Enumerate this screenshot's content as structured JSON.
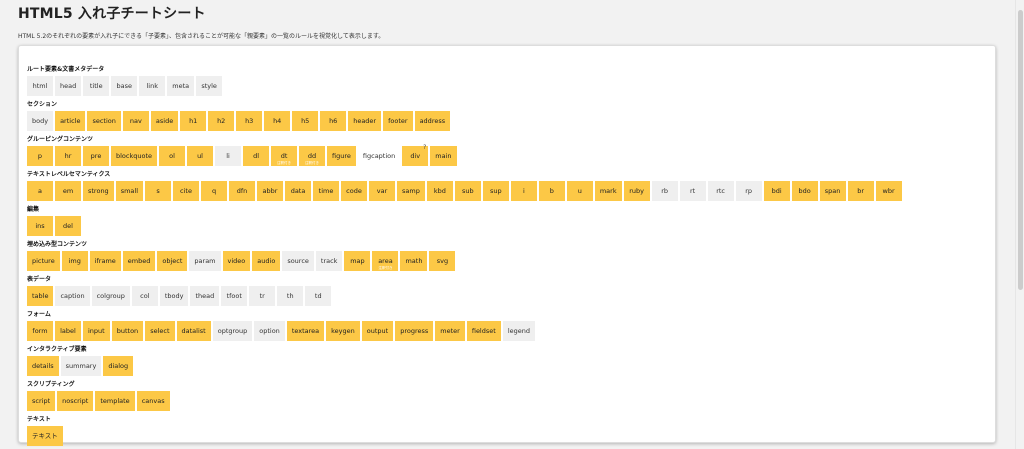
{
  "title": "HTML5 入れ子チートシート",
  "description": "HTML 5.2のそれぞれの要素が入れ子にできる「子要素」、包含されることが可能な「親要素」の一覧のルールを視覚化して表示します。",
  "colors": {
    "highlight": "#fcc846",
    "neutral": "#efefef"
  },
  "sections": [
    {
      "title": "ルート要素&文書メタデータ",
      "items": [
        {
          "label": "html",
          "state": "g"
        },
        {
          "label": "head",
          "state": "g"
        },
        {
          "label": "title",
          "state": "g"
        },
        {
          "label": "base",
          "state": "g"
        },
        {
          "label": "link",
          "state": "g"
        },
        {
          "label": "meta",
          "state": "g"
        },
        {
          "label": "style",
          "state": "g"
        }
      ]
    },
    {
      "title": "セクション",
      "items": [
        {
          "label": "body",
          "state": "g"
        },
        {
          "label": "article",
          "state": "y"
        },
        {
          "label": "section",
          "state": "y"
        },
        {
          "label": "nav",
          "state": "y"
        },
        {
          "label": "aside",
          "state": "y"
        },
        {
          "label": "h1",
          "state": "y"
        },
        {
          "label": "h2",
          "state": "y"
        },
        {
          "label": "h3",
          "state": "y"
        },
        {
          "label": "h4",
          "state": "y"
        },
        {
          "label": "h5",
          "state": "y"
        },
        {
          "label": "h6",
          "state": "y"
        },
        {
          "label": "header",
          "state": "y"
        },
        {
          "label": "footer",
          "state": "y"
        },
        {
          "label": "address",
          "state": "y"
        }
      ]
    },
    {
      "title": "グルーピングコンテンツ",
      "items": [
        {
          "label": "p",
          "state": "y"
        },
        {
          "label": "hr",
          "state": "y"
        },
        {
          "label": "pre",
          "state": "y"
        },
        {
          "label": "blockquote",
          "state": "y"
        },
        {
          "label": "ol",
          "state": "y"
        },
        {
          "label": "ul",
          "state": "y"
        },
        {
          "label": "li",
          "state": "g"
        },
        {
          "label": "dl",
          "state": "y"
        },
        {
          "label": "dt",
          "state": "y",
          "sub": "注釈付き"
        },
        {
          "label": "dd",
          "state": "y",
          "sub": "注釈付き"
        },
        {
          "label": "figure",
          "state": "y"
        },
        {
          "label": "figcaption",
          "state": "w"
        },
        {
          "label": "div",
          "state": "y",
          "mark": "?"
        },
        {
          "label": "main",
          "state": "y"
        }
      ]
    },
    {
      "title": "テキストレベルセマンティクス",
      "items": [
        {
          "label": "a",
          "state": "y"
        },
        {
          "label": "em",
          "state": "y"
        },
        {
          "label": "strong",
          "state": "y"
        },
        {
          "label": "small",
          "state": "y"
        },
        {
          "label": "s",
          "state": "y"
        },
        {
          "label": "cite",
          "state": "y"
        },
        {
          "label": "q",
          "state": "y"
        },
        {
          "label": "dfn",
          "state": "y"
        },
        {
          "label": "abbr",
          "state": "y"
        },
        {
          "label": "data",
          "state": "y"
        },
        {
          "label": "time",
          "state": "y"
        },
        {
          "label": "code",
          "state": "y"
        },
        {
          "label": "var",
          "state": "y"
        },
        {
          "label": "samp",
          "state": "y"
        },
        {
          "label": "kbd",
          "state": "y"
        },
        {
          "label": "sub",
          "state": "y"
        },
        {
          "label": "sup",
          "state": "y"
        },
        {
          "label": "i",
          "state": "y"
        },
        {
          "label": "b",
          "state": "y"
        },
        {
          "label": "u",
          "state": "y"
        },
        {
          "label": "mark",
          "state": "y"
        },
        {
          "label": "ruby",
          "state": "y"
        },
        {
          "label": "rb",
          "state": "g"
        },
        {
          "label": "rt",
          "state": "g"
        },
        {
          "label": "rtc",
          "state": "g"
        },
        {
          "label": "rp",
          "state": "g"
        },
        {
          "label": "bdi",
          "state": "y"
        },
        {
          "label": "bdo",
          "state": "y"
        },
        {
          "label": "span",
          "state": "y"
        },
        {
          "label": "br",
          "state": "y"
        },
        {
          "label": "wbr",
          "state": "y"
        }
      ]
    },
    {
      "title": "編集",
      "items": [
        {
          "label": "ins",
          "state": "y"
        },
        {
          "label": "del",
          "state": "y"
        }
      ]
    },
    {
      "title": "埋め込み型コンテンツ",
      "items": [
        {
          "label": "picture",
          "state": "y"
        },
        {
          "label": "img",
          "state": "y"
        },
        {
          "label": "iframe",
          "state": "y"
        },
        {
          "label": "embed",
          "state": "y"
        },
        {
          "label": "object",
          "state": "y"
        },
        {
          "label": "param",
          "state": "g"
        },
        {
          "label": "video",
          "state": "y"
        },
        {
          "label": "audio",
          "state": "y"
        },
        {
          "label": "source",
          "state": "g"
        },
        {
          "label": "track",
          "state": "g"
        },
        {
          "label": "map",
          "state": "y"
        },
        {
          "label": "area",
          "state": "y",
          "sub": "注釈付き"
        },
        {
          "label": "math",
          "state": "y"
        },
        {
          "label": "svg",
          "state": "y"
        }
      ]
    },
    {
      "title": "表データ",
      "items": [
        {
          "label": "table",
          "state": "y"
        },
        {
          "label": "caption",
          "state": "g"
        },
        {
          "label": "colgroup",
          "state": "g"
        },
        {
          "label": "col",
          "state": "g"
        },
        {
          "label": "tbody",
          "state": "g"
        },
        {
          "label": "thead",
          "state": "g"
        },
        {
          "label": "tfoot",
          "state": "g"
        },
        {
          "label": "tr",
          "state": "g"
        },
        {
          "label": "th",
          "state": "g"
        },
        {
          "label": "td",
          "state": "g"
        }
      ]
    },
    {
      "title": "フォーム",
      "items": [
        {
          "label": "form",
          "state": "y"
        },
        {
          "label": "label",
          "state": "y"
        },
        {
          "label": "input",
          "state": "y"
        },
        {
          "label": "button",
          "state": "y"
        },
        {
          "label": "select",
          "state": "y"
        },
        {
          "label": "datalist",
          "state": "y"
        },
        {
          "label": "optgroup",
          "state": "g"
        },
        {
          "label": "option",
          "state": "g"
        },
        {
          "label": "textarea",
          "state": "y"
        },
        {
          "label": "keygen",
          "state": "y"
        },
        {
          "label": "output",
          "state": "y"
        },
        {
          "label": "progress",
          "state": "y"
        },
        {
          "label": "meter",
          "state": "y"
        },
        {
          "label": "fieldset",
          "state": "y"
        },
        {
          "label": "legend",
          "state": "g"
        }
      ]
    },
    {
      "title": "インタラクティブ要素",
      "items": [
        {
          "label": "details",
          "state": "y"
        },
        {
          "label": "summary",
          "state": "g"
        },
        {
          "label": "dialog",
          "state": "y"
        }
      ]
    },
    {
      "title": "スクリプティング",
      "items": [
        {
          "label": "script",
          "state": "y"
        },
        {
          "label": "noscript",
          "state": "y"
        },
        {
          "label": "template",
          "state": "y"
        },
        {
          "label": "canvas",
          "state": "y"
        }
      ]
    },
    {
      "title": "テキスト",
      "items": [
        {
          "label": "テキスト",
          "state": "y"
        }
      ]
    }
  ]
}
